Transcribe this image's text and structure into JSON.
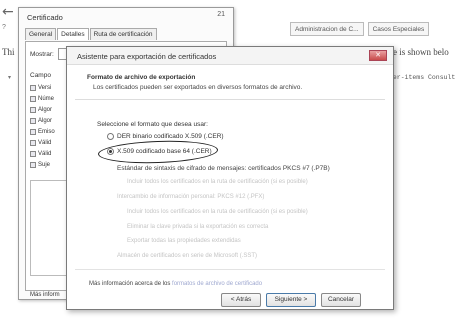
{
  "background": {
    "back_arrow": "←",
    "number": "?",
    "left_text": "Thi",
    "bullet": "▾",
    "tabs": [
      "Administracion de C...",
      "Casos Especiales"
    ],
    "right_text": "ree is shown belo",
    "code_text": "ser-items Consult"
  },
  "cert_window": {
    "title": "Certificado",
    "close": "21",
    "tabs": [
      "General",
      "Detalles",
      "Ruta de certificación"
    ],
    "show_label": "Mostrar:",
    "field_header": "Campo",
    "fields": [
      "Versi",
      "Núme",
      "Algor",
      "Algor",
      "Emiso",
      "Válid",
      "Válid",
      "Suje"
    ],
    "more_info": "Más inform"
  },
  "wizard": {
    "title": "Asistente para exportación de certificados",
    "close": "✕",
    "heading": "Formato de archivo de exportación",
    "subheading": "Los certificados pueden ser exportados en diversos formatos de archivo.",
    "prompt": "Seleccione el formato que desea usar:",
    "option_der": "DER binario codificado X.509 (.CER)",
    "option_base64": "X.509 codificado base 64 (.CER)",
    "option_pkcs7": "Estándar de sintaxis de cifrado de mensajes: certificados PKCS #7 (.P7B)",
    "dim_options": [
      "Incluir todos los certificados en la ruta de certificación (si es posible)",
      "Intercambio de información personal: PKCS #12 (.PFX)",
      "Incluir todos los certificados en la ruta de certificación (si es posible)",
      "Eliminar la clave privada si la exportación es correcta",
      "Exportar todas las propiedades extendidas",
      "Almacén de certificados en serie de Microsoft (.SST)"
    ],
    "more_info_prefix": "Más información acerca de los",
    "more_info_link": "formatos de archivo de certificado",
    "btn_back": "< Atrás",
    "btn_next": "Siguiente >",
    "btn_cancel": "Cancelar"
  }
}
